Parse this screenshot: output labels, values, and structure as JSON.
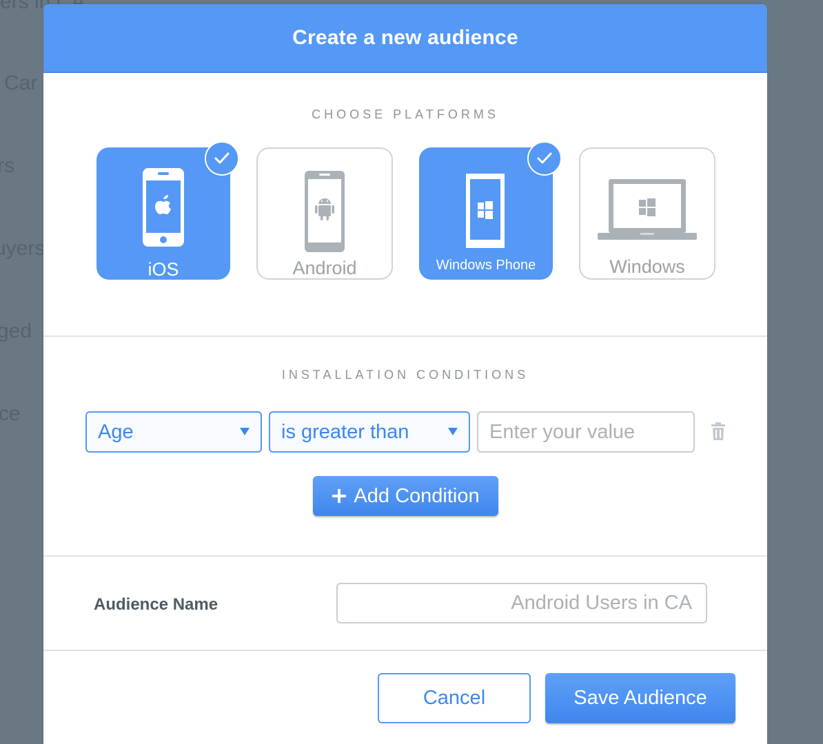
{
  "background": {
    "fragments": [
      "ers in CA",
      "Car",
      "rs",
      "uyers",
      "ged",
      "ce"
    ]
  },
  "modal": {
    "title": "Create a new audience"
  },
  "platforms": {
    "section_title": "CHOOSE PLATFORMS",
    "items": [
      {
        "label": "iOS",
        "selected": true,
        "icon": "iphone-apple-icon"
      },
      {
        "label": "Android",
        "selected": false,
        "icon": "android-phone-icon"
      },
      {
        "label": "Windows Phone",
        "selected": true,
        "icon": "windows-phone-icon"
      },
      {
        "label": "Windows",
        "selected": false,
        "icon": "windows-laptop-icon"
      }
    ]
  },
  "conditions": {
    "section_title": "INSTALLATION CONDITIONS",
    "field_select": "Age",
    "operator_select": "is greater than",
    "value_placeholder": "Enter your value",
    "value": "",
    "add_label": "Add Condition"
  },
  "audience_name": {
    "label": "Audience Name",
    "placeholder": "Android Users in CA",
    "value": ""
  },
  "footer": {
    "cancel_label": "Cancel",
    "save_label": "Save Audience"
  },
  "colors": {
    "accent": "#5598f5",
    "overlay": "#6a7884",
    "muted_text": "#9aa2a9"
  }
}
